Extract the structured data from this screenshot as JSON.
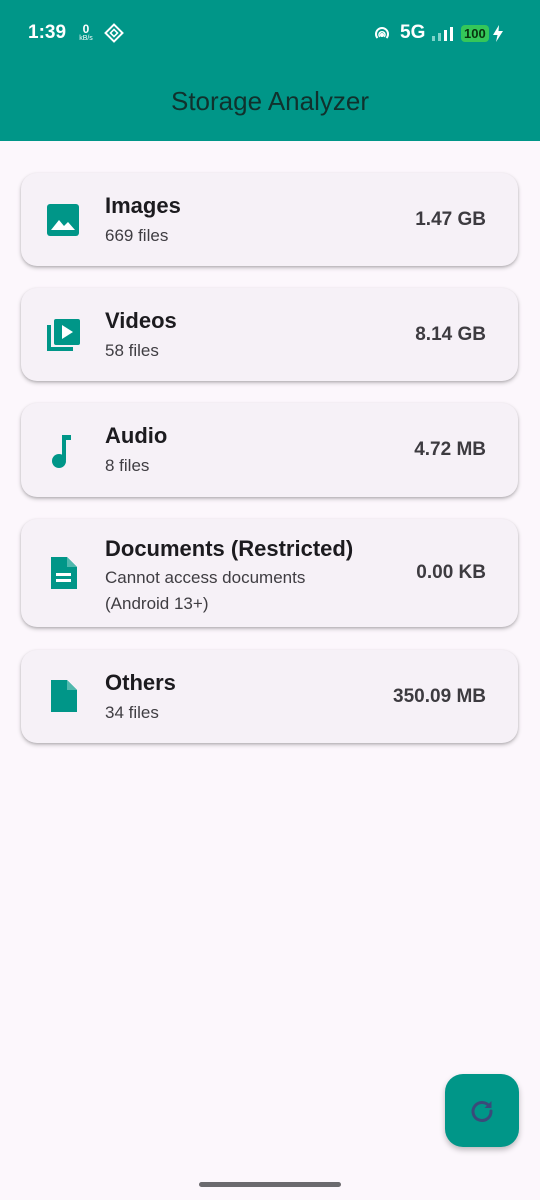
{
  "status_bar": {
    "time": "1:39",
    "speed_value": "0",
    "speed_unit": "kB/s",
    "network": "5G",
    "battery": "100"
  },
  "app_bar": {
    "title": "Storage Analyzer",
    "color": "#009688"
  },
  "categories": [
    {
      "name": "Images",
      "subtitle": "669 files",
      "size": "1.47 GB",
      "icon": "image-icon"
    },
    {
      "name": "Videos",
      "subtitle": "58 files",
      "size": "8.14 GB",
      "icon": "video-library-icon"
    },
    {
      "name": "Audio",
      "subtitle": "8 files",
      "size": "4.72 MB",
      "icon": "music-note-icon"
    },
    {
      "name": "Documents (Restricted)",
      "subtitle": "Cannot access documents (Android 13+)",
      "size": "0.00 KB",
      "icon": "document-icon"
    },
    {
      "name": "Others",
      "subtitle": "34 files",
      "size": "350.09 MB",
      "icon": "file-icon"
    }
  ],
  "fab": {
    "icon": "refresh-icon"
  },
  "colors": {
    "accent": "#009688",
    "background": "#fcf7fc",
    "card": "#f6f1f7"
  }
}
